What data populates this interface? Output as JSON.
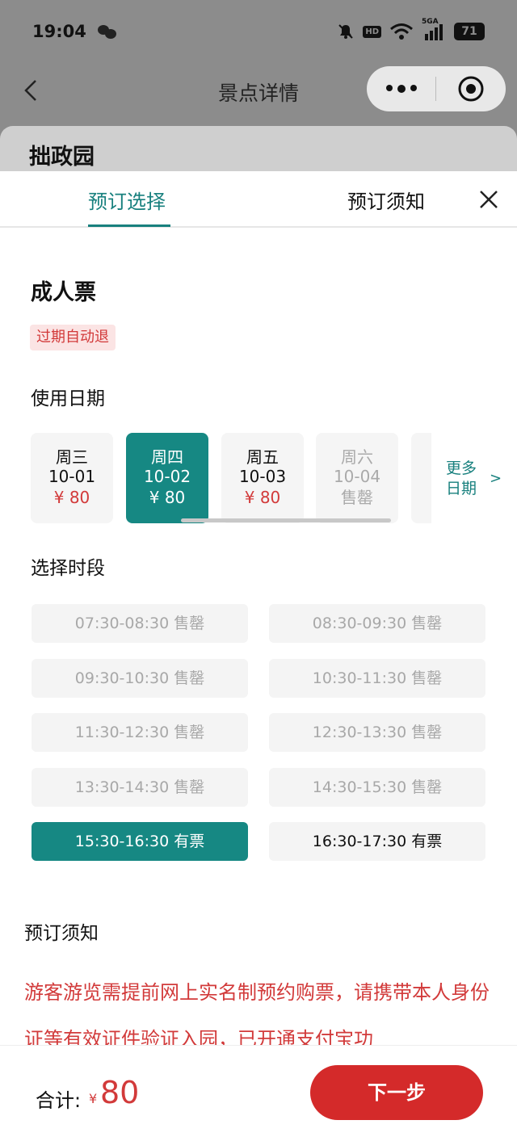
{
  "status_bar": {
    "time": "19:04",
    "hd": "HD",
    "network": "5GA",
    "battery": "71"
  },
  "nav": {
    "title": "景点详情"
  },
  "attraction": {
    "name": "拙政园"
  },
  "tabs": [
    {
      "label": "预订选择",
      "active": true
    },
    {
      "label": "预订须知",
      "active": false
    }
  ],
  "ticket": {
    "name": "成人票",
    "tag": "过期自动退"
  },
  "date_section": {
    "label": "使用日期",
    "dates": [
      {
        "weekday": "周三",
        "date": "10-01",
        "status": "¥ 80",
        "state": "normal"
      },
      {
        "weekday": "周四",
        "date": "10-02",
        "status": "¥ 80",
        "state": "selected"
      },
      {
        "weekday": "周五",
        "date": "10-03",
        "status": "¥ 80",
        "state": "normal"
      },
      {
        "weekday": "周六",
        "date": "10-04",
        "status": "售罄",
        "state": "disabled"
      }
    ],
    "more_line1": "更多",
    "more_line2": "日期",
    "more_arrow": ">"
  },
  "time_section": {
    "label": "选择时段",
    "slots": [
      {
        "text": "07:30-08:30 售罄",
        "state": "soldout"
      },
      {
        "text": "08:30-09:30 售罄",
        "state": "soldout"
      },
      {
        "text": "09:30-10:30 售罄",
        "state": "soldout"
      },
      {
        "text": "10:30-11:30 售罄",
        "state": "soldout"
      },
      {
        "text": "11:30-12:30 售罄",
        "state": "soldout"
      },
      {
        "text": "12:30-13:30 售罄",
        "state": "soldout"
      },
      {
        "text": "13:30-14:30 售罄",
        "state": "soldout"
      },
      {
        "text": "14:30-15:30 售罄",
        "state": "soldout"
      },
      {
        "text": "15:30-16:30 有票",
        "state": "selected"
      },
      {
        "text": "16:30-17:30 有票",
        "state": "available"
      }
    ]
  },
  "notice": {
    "label": "预订须知",
    "text": "游客游览需提前网上实名制预约购票，请携带本人身份证等有效证件验证入园，已开通支付宝功"
  },
  "footer": {
    "total_label": "合计:",
    "currency": "¥",
    "amount": "80",
    "next_label": "下一步"
  },
  "colors": {
    "accent": "#168883",
    "price_red": "#d23a3a",
    "button_red": "#d42a2a"
  }
}
